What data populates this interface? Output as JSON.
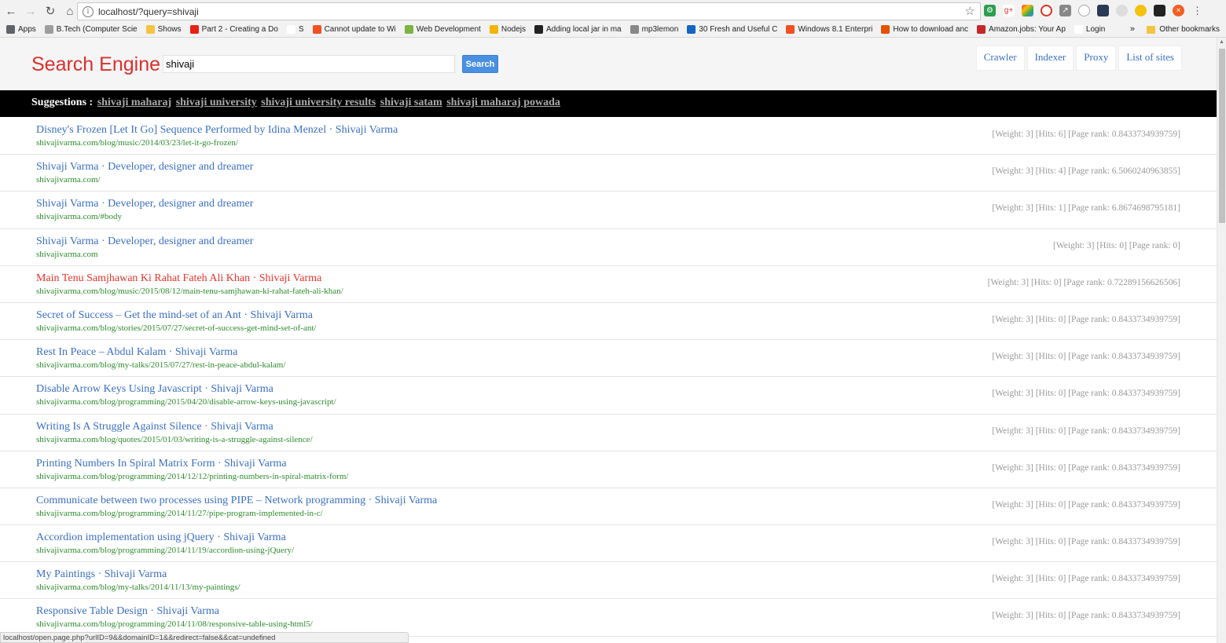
{
  "browser": {
    "url": "localhost/?query=shivaji",
    "bookmarks": [
      {
        "label": "Apps",
        "color": "#5f6368"
      },
      {
        "label": "B.Tech (Computer Scie",
        "color": "#9e9e9e"
      },
      {
        "label": "Shows",
        "color": "#f5c342"
      },
      {
        "label": "Part 2 - Creating a Do",
        "color": "#e62117"
      },
      {
        "label": "S",
        "color": "#ffffff"
      },
      {
        "label": "Cannot update to Wi",
        "color": "#f25022"
      },
      {
        "label": "Web Development",
        "color": "#7cb342"
      },
      {
        "label": "Nodejs",
        "color": "#f4b400"
      },
      {
        "label": "Adding local jar in ma",
        "color": "#222222"
      },
      {
        "label": "mp3lemon",
        "color": "#888888"
      },
      {
        "label": "30 Fresh and Useful C",
        "color": "#1565c0"
      },
      {
        "label": "Windows 8.1 Enterpri",
        "color": "#f25022"
      },
      {
        "label": "How to download anc",
        "color": "#e65100"
      },
      {
        "label": "Amazon.jobs: Your Ap",
        "color": "#c62828"
      },
      {
        "label": "Login",
        "color": "#ffffff"
      }
    ],
    "bookmarks_more": "»",
    "other_bookmarks": "Other bookmarks",
    "status_url": "localhost/open.page.php?urlID=9&&domainID=1&&redirect=false&&cat=undefined"
  },
  "header": {
    "logo": "Search Engine",
    "query": "shivaji",
    "search_label": "Search",
    "nav": [
      "Crawler",
      "Indexer",
      "Proxy",
      "List of sites"
    ]
  },
  "suggestions": {
    "label": "Suggestions :",
    "items": [
      "shivaji maharaj",
      "shivaji university",
      "shivaji university results",
      "shivaji satam",
      "shivaji maharaj powada"
    ]
  },
  "results": [
    {
      "title": "Disney's Frozen [Let It Go] Sequence Performed by Idina Menzel · Shivaji Varma",
      "url": "shivajivarma.com/blog/music/2014/03/23/let-it-go-frozen/",
      "meta": "[Weight: 3] [Hits: 6] [Page rank: 0.8433734939759]",
      "visited": false
    },
    {
      "title": "Shivaji Varma · Developer, designer and dreamer",
      "url": "shivajivarma.com/",
      "meta": "[Weight: 3] [Hits: 4] [Page rank: 6.5060240963855]",
      "visited": false
    },
    {
      "title": "Shivaji Varma · Developer, designer and dreamer",
      "url": "shivajivarma.com/#body",
      "meta": "[Weight: 3] [Hits: 1] [Page rank: 6.8674698795181]",
      "visited": false
    },
    {
      "title": "Shivaji Varma · Developer, designer and dreamer",
      "url": "shivajivarma.com",
      "meta": "[Weight: 3] [Hits: 0] [Page rank: 0]",
      "visited": false
    },
    {
      "title": "Main Tenu Samjhawan Ki Rahat Fateh Ali Khan · Shivaji Varma",
      "url": "shivajivarma.com/blog/music/2015/08/12/main-tenu-samjhawan-ki-rahat-fateh-ali-khan/",
      "meta": "[Weight: 3] [Hits: 0] [Page rank: 0.72289156626506]",
      "visited": true
    },
    {
      "title": "Secret of Success – Get the mind-set of an Ant · Shivaji Varma",
      "url": "shivajivarma.com/blog/stories/2015/07/27/secret-of-success-get-mind-set-of-ant/",
      "meta": "[Weight: 3] [Hits: 0] [Page rank: 0.8433734939759]",
      "visited": false
    },
    {
      "title": "Rest In Peace – Abdul Kalam · Shivaji Varma",
      "url": "shivajivarma.com/blog/my-talks/2015/07/27/rest-in-peace-abdul-kalam/",
      "meta": "[Weight: 3] [Hits: 0] [Page rank: 0.8433734939759]",
      "visited": false
    },
    {
      "title": "Disable Arrow Keys Using Javascript · Shivaji Varma",
      "url": "shivajivarma.com/blog/programming/2015/04/20/disable-arrow-keys-using-javascript/",
      "meta": "[Weight: 3] [Hits: 0] [Page rank: 0.8433734939759]",
      "visited": false
    },
    {
      "title": "Writing Is A Struggle Against Silence · Shivaji Varma",
      "url": "shivajivarma.com/blog/quotes/2015/01/03/writing-is-a-struggle-against-silence/",
      "meta": "[Weight: 3] [Hits: 0] [Page rank: 0.8433734939759]",
      "visited": false
    },
    {
      "title": "Printing Numbers In Spiral Matrix Form · Shivaji Varma",
      "url": "shivajivarma.com/blog/programming/2014/12/12/printing-numbers-in-spiral-matrix-form/",
      "meta": "[Weight: 3] [Hits: 0] [Page rank: 0.8433734939759]",
      "visited": false
    },
    {
      "title": "Communicate between two processes using PIPE – Network programming · Shivaji Varma",
      "url": "shivajivarma.com/blog/programming/2014/11/27/pipe-program-implemented-in-c/",
      "meta": "[Weight: 3] [Hits: 0] [Page rank: 0.8433734939759]",
      "visited": false
    },
    {
      "title": "Accordion implementation using jQuery · Shivaji Varma",
      "url": "shivajivarma.com/blog/programming/2014/11/19/accordion-using-jQuery/",
      "meta": "[Weight: 3] [Hits: 0] [Page rank: 0.8433734939759]",
      "visited": false
    },
    {
      "title": "My Paintings · Shivaji Varma",
      "url": "shivajivarma.com/blog/my-talks/2014/11/13/my-paintings/",
      "meta": "[Weight: 3] [Hits: 0] [Page rank: 0.8433734939759]",
      "visited": false
    },
    {
      "title": "Responsive Table Design · Shivaji Varma",
      "url": "shivajivarma.com/blog/programming/2014/11/08/responsive-table-using-html5/",
      "meta": "[Weight: 3] [Hits: 0] [Page rank: 0.8433734939759]",
      "visited": false
    }
  ]
}
